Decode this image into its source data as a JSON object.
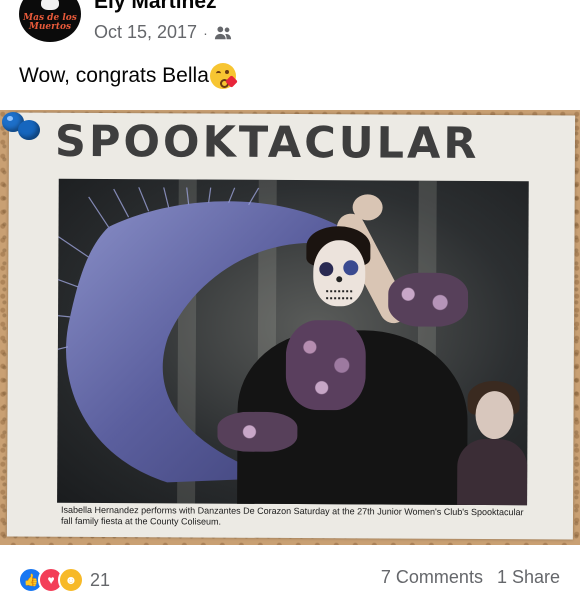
{
  "post": {
    "author": "Ely Martinez",
    "avatar_text": "Mas de los Muertos",
    "date": "Oct 15, 2017",
    "separator": "·",
    "audience_icon": "friends-icon",
    "text": "Wow, congrats Bella",
    "emoji": "kissing-face-with-heart-emoji"
  },
  "photo": {
    "headline": "SPOOKTACULAR",
    "caption": "Isabella Hernandez performs with Danzantes De Corazon Saturday at the 27th Junior Women's Club's Spooktacular fall family fiesta at the County Coliseum.",
    "pin_color": "#1d6fc9"
  },
  "footer": {
    "reaction_icons": [
      "like-icon",
      "love-icon",
      "haha-icon"
    ],
    "reaction_count": "21",
    "comments": "7 Comments",
    "shares": "1 Share"
  },
  "colors": {
    "meta_gray": "#65676b",
    "like_blue": "#1877f2",
    "love_red": "#f33e58",
    "haha_yellow": "#f7b928"
  }
}
